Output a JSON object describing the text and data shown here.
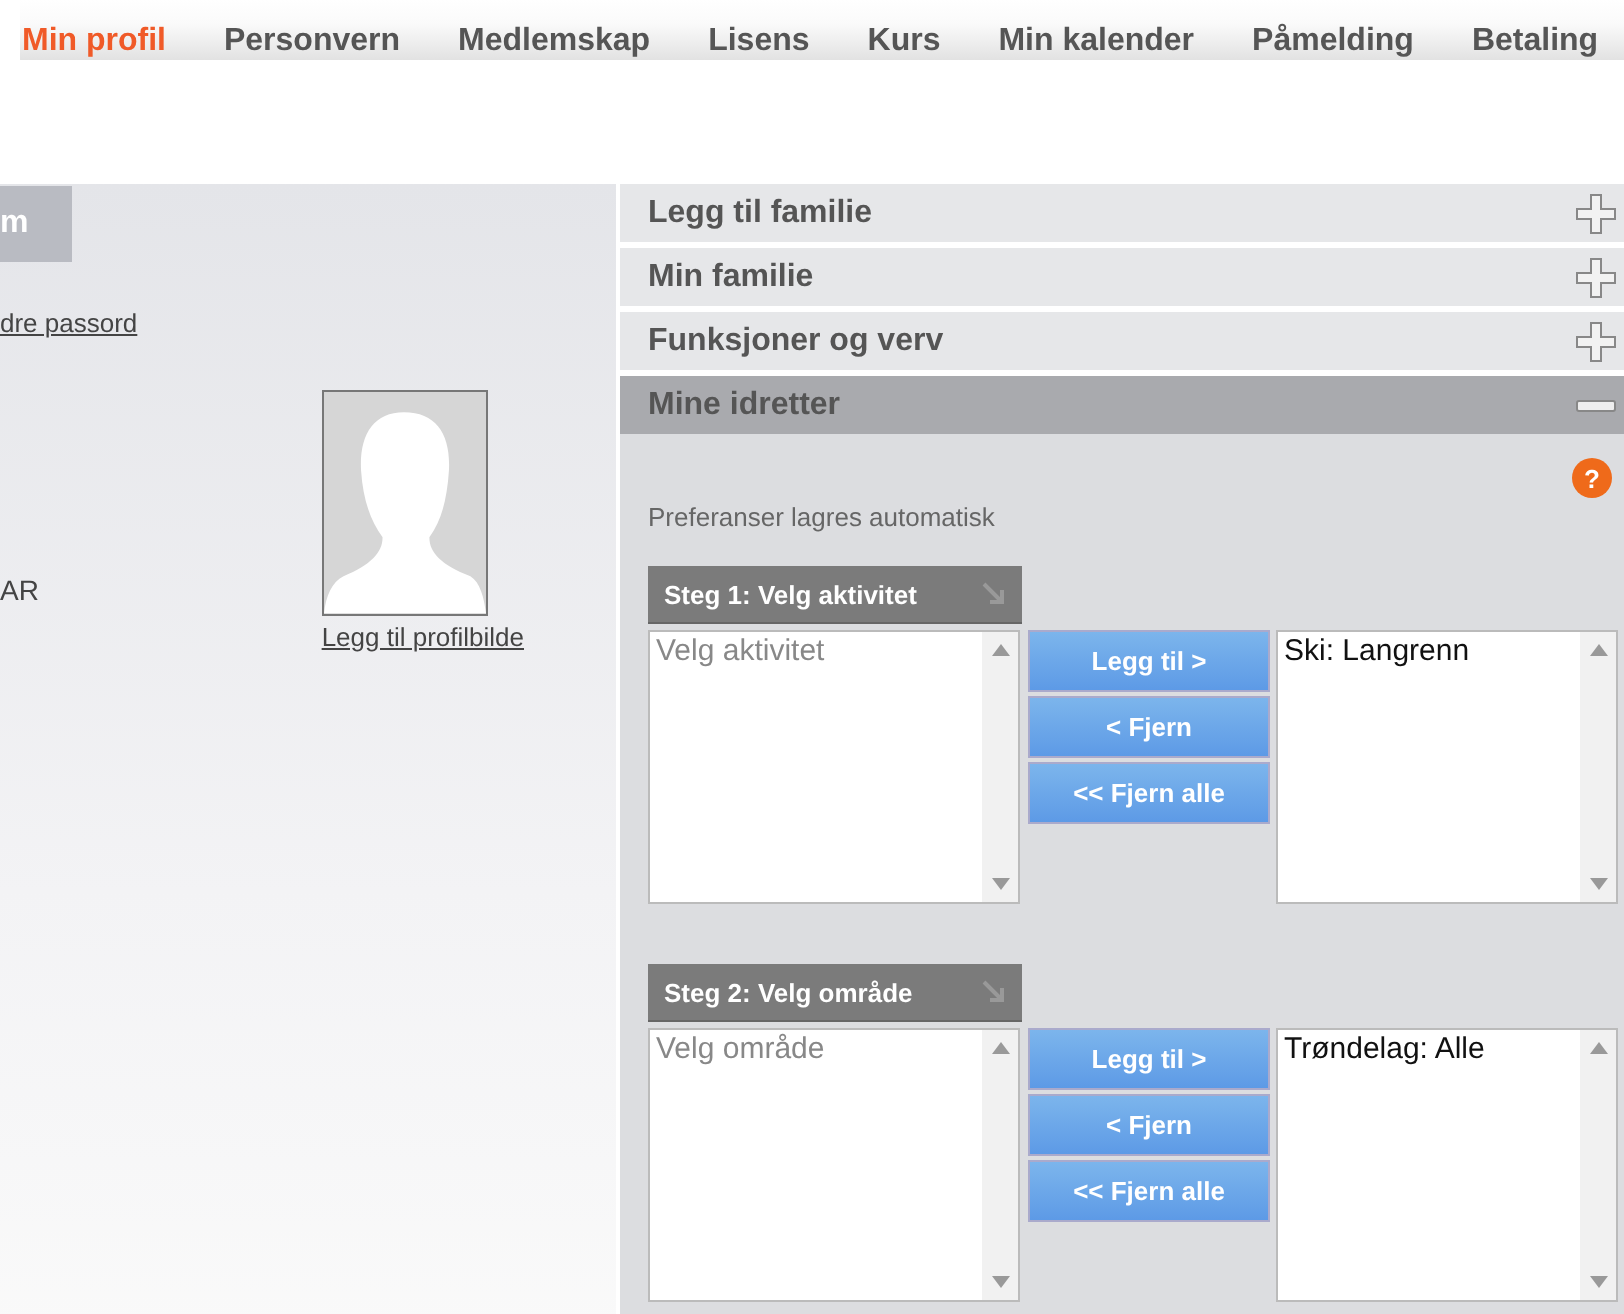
{
  "nav": [
    {
      "label": "Min profil",
      "selected": true
    },
    {
      "label": "Personvern",
      "selected": false
    },
    {
      "label": "Medlemskap",
      "selected": false
    },
    {
      "label": "Lisens",
      "selected": false
    },
    {
      "label": "Kurs",
      "selected": false
    },
    {
      "label": "Min kalender",
      "selected": false
    },
    {
      "label": "Påmelding",
      "selected": false
    },
    {
      "label": "Betaling",
      "selected": false
    }
  ],
  "profile": {
    "tab_label": "m",
    "password_link": "dre passord",
    "field_value": "AR",
    "photo_link": "Legg til profilbilde"
  },
  "sections": [
    {
      "title": "Legg til familie",
      "expanded": false
    },
    {
      "title": "Min familie",
      "expanded": false
    },
    {
      "title": "Funksjoner og verv",
      "expanded": false
    },
    {
      "title": "Mine idretter",
      "expanded": true
    }
  ],
  "sports": {
    "note": "Preferanser lagres automatisk",
    "help": "?",
    "steps": [
      {
        "title": "Steg 1: Velg aktivitet",
        "placeholder": "Velg aktivitet",
        "buttons": [
          "Legg til >",
          "< Fjern",
          "<< Fjern alle"
        ],
        "chosen": [
          "Ski: Langrenn"
        ]
      },
      {
        "title": "Steg 2: Velg område",
        "placeholder": "Velg område",
        "buttons": [
          "Legg til >",
          "< Fjern",
          "<< Fjern alle"
        ],
        "chosen": [
          "Trøndelag: Alle"
        ]
      }
    ]
  }
}
